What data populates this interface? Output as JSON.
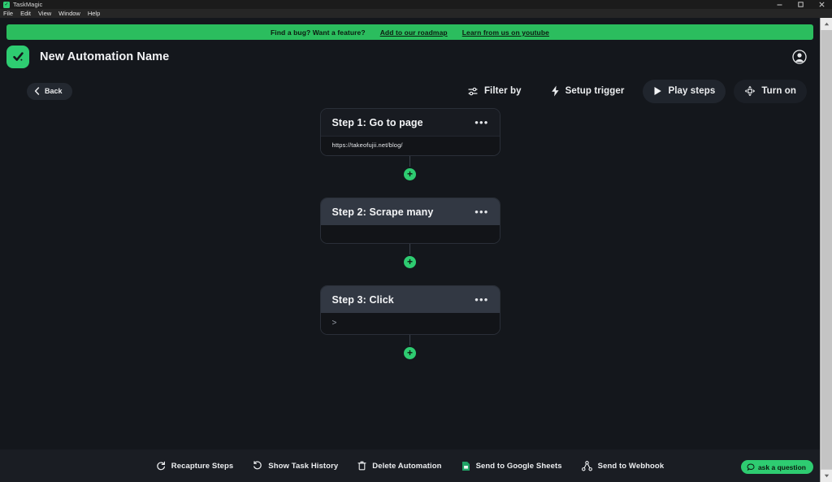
{
  "window": {
    "app_name": "TaskMagic",
    "controls": [
      {
        "name": "minimize",
        "glyph": "minimize-icon"
      },
      {
        "name": "maximize",
        "glyph": "maximize-icon"
      },
      {
        "name": "close",
        "glyph": "close-icon"
      }
    ],
    "menus": [
      "File",
      "Edit",
      "View",
      "Window",
      "Help"
    ]
  },
  "banner": {
    "text": "Find a bug? Want a feature?",
    "link1": "Add to our roadmap",
    "link2": "Learn from us on youtube",
    "color": "#2bbd5e"
  },
  "header": {
    "title": "New Automation Name",
    "logo_icon": "taskmagic-check-logo",
    "account_icon": "account-circle-icon"
  },
  "toolbar": {
    "back_label": "Back",
    "back_icon": "chevron-left-icon",
    "actions": [
      {
        "label": "Filter by",
        "icon": "filter-sliders-icon",
        "style": "plain"
      },
      {
        "label": "Setup trigger",
        "icon": "lightning-bolt-icon",
        "style": "plain"
      },
      {
        "label": "Play steps",
        "icon": "play-icon",
        "style": "filled"
      },
      {
        "label": "Turn on",
        "icon": "power-move-icon",
        "style": "dark"
      }
    ]
  },
  "flow": {
    "add_step_icon": "plus-circle-icon",
    "menu_icon": "more-options-icon",
    "steps": [
      {
        "title": "Step 1: Go to page",
        "body": "https://takeofujii.net/blog/",
        "body_style": "url",
        "active": false
      },
      {
        "title": "Step 2: Scrape many",
        "body": "",
        "body_style": "empty",
        "active": true
      },
      {
        "title": "Step 3: Click",
        "body": ">",
        "body_style": "mono",
        "active": true
      }
    ]
  },
  "bottom_bar": {
    "items": [
      {
        "label": "Recapture Steps",
        "icon": "recapture-refresh-icon"
      },
      {
        "label": "Show Task History",
        "icon": "history-clock-icon"
      },
      {
        "label": "Delete Automation",
        "icon": "trash-icon"
      },
      {
        "label": "Send to Google Sheets",
        "icon": "google-sheets-icon"
      },
      {
        "label": "Send to Webhook",
        "icon": "webhook-share-icon"
      }
    ],
    "ask_label": "ask a question",
    "ask_icon": "chat-bubble-icon"
  }
}
